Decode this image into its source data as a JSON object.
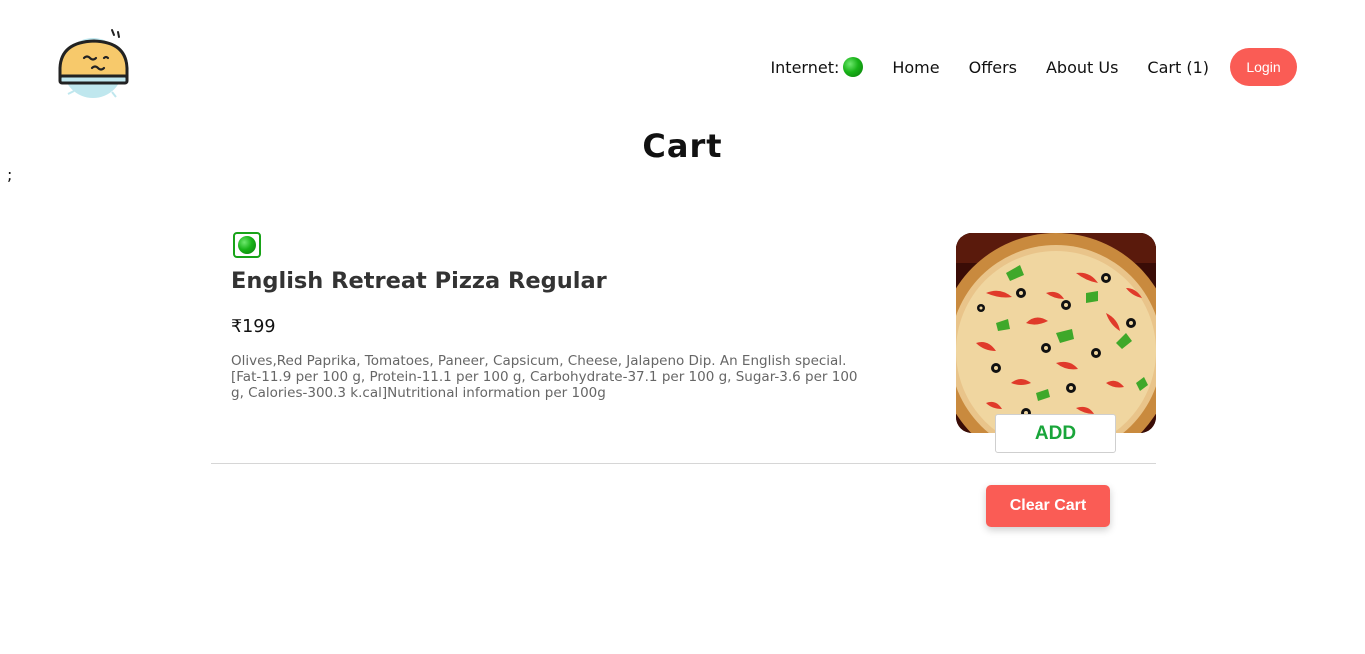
{
  "header": {
    "logo_icon": "food-delivery-logo-icon",
    "nav": {
      "internet_label": "Internet:",
      "internet_status_color": "#18b318",
      "home": "Home",
      "offers": "Offers",
      "about": "About Us",
      "cart": "Cart (1)",
      "login": "Login"
    }
  },
  "main": {
    "title": "Cart",
    "stray_text": ";"
  },
  "cart": {
    "items": [
      {
        "veg_icon": "veg-indicator-icon",
        "name": "English Retreat Pizza Regular",
        "price": "₹199",
        "description": "Olives,Red Paprika, Tomatoes, Paneer, Capsicum, Cheese, Jalapeno Dip. An English special. [Fat-11.9 per 100 g, Protein-11.1 per 100 g, Carbohydrate-37.1 per 100 g, Sugar-3.6 per 100 g, Calories-300.3 k.cal]Nutritional information per 100g",
        "add_label": "ADD"
      }
    ],
    "clear_label": "Clear Cart"
  },
  "colors": {
    "accent": "#fa5c55",
    "add_text": "#19a53a",
    "veg_green": "#18a318"
  }
}
